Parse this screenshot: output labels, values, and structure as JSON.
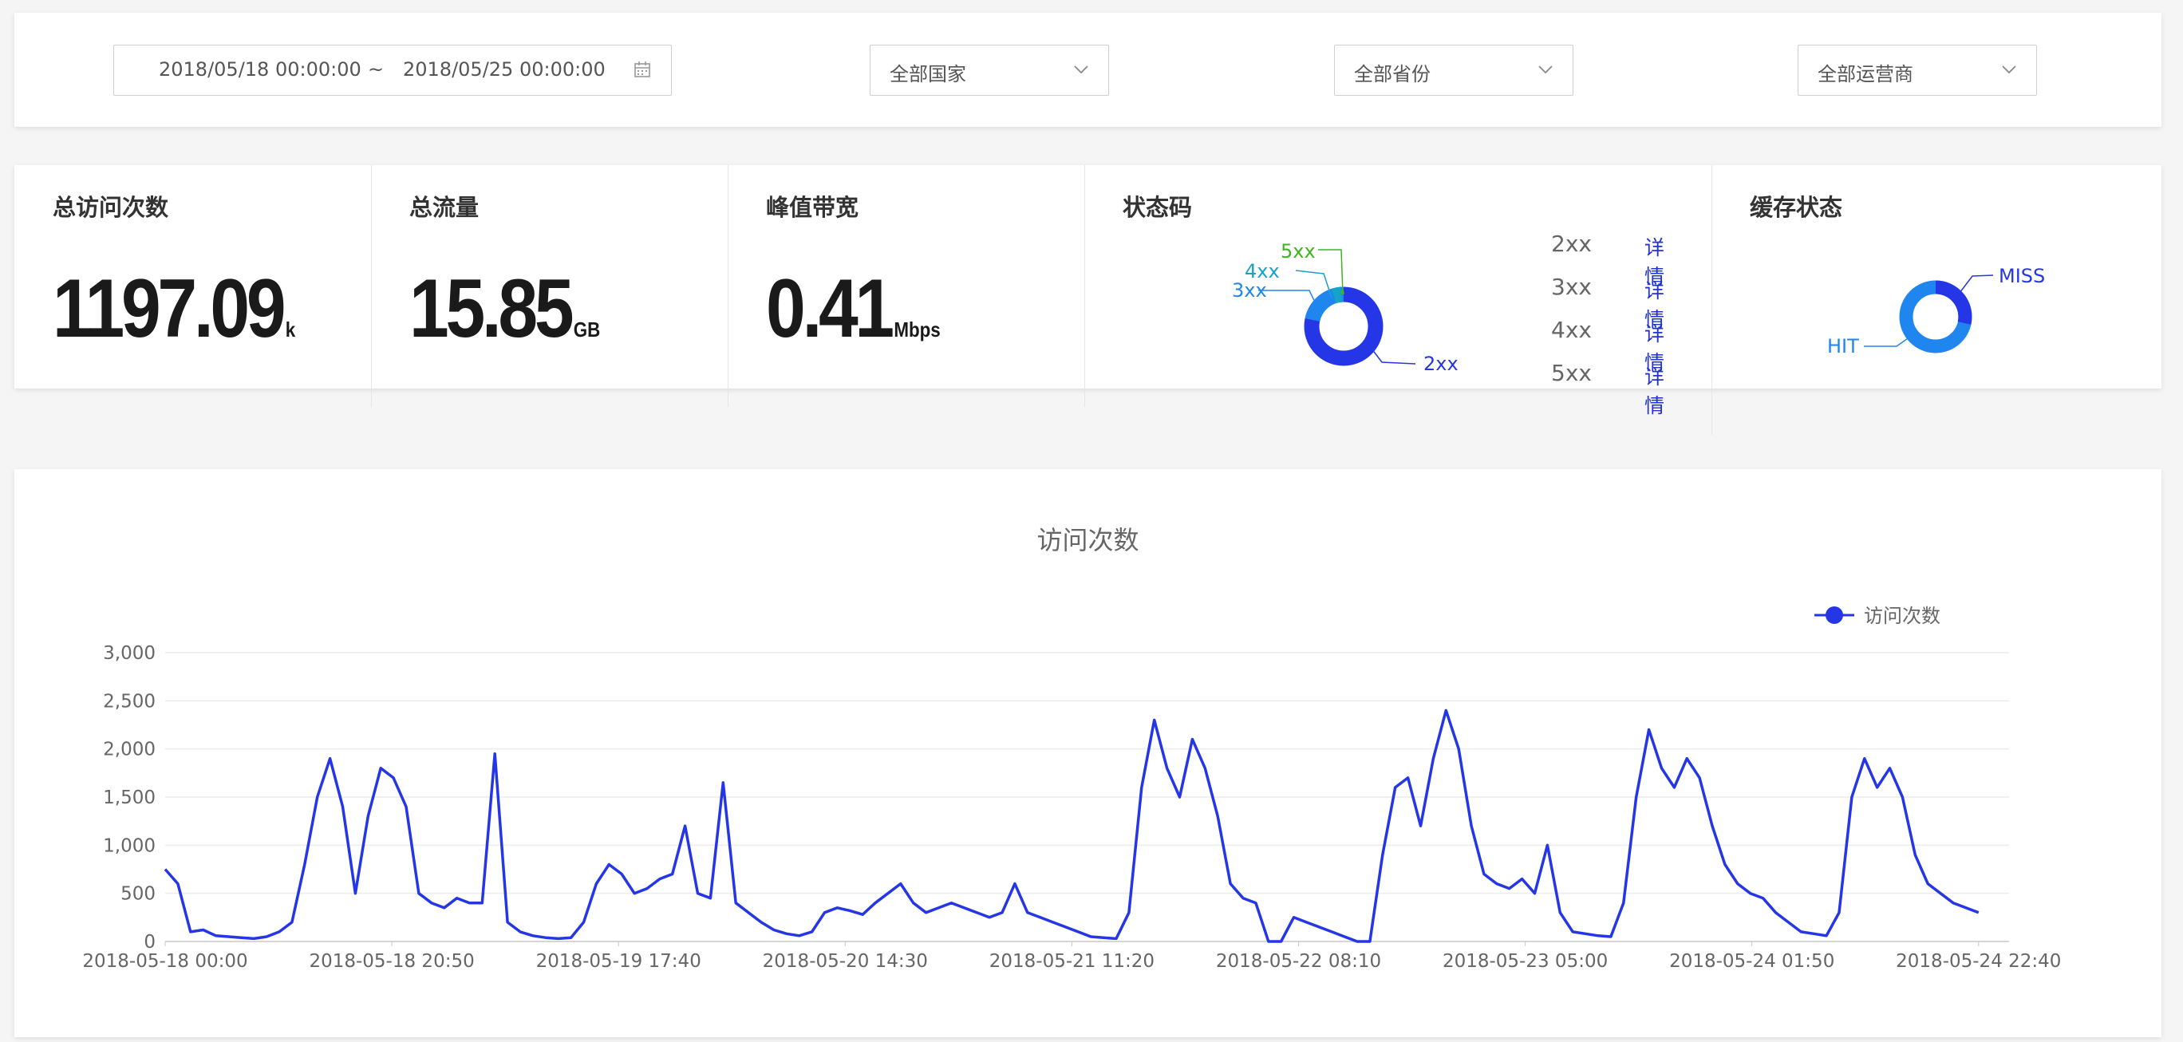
{
  "filters": {
    "date_start": "2018/05/18 00:00:00",
    "date_sep": "~",
    "date_end": "2018/05/25 00:00:00",
    "country": "全部国家",
    "province": "全部省份",
    "isp": "全部运营商"
  },
  "stats": {
    "visits": {
      "title": "总访问次数",
      "value": "1197.09",
      "unit": "k"
    },
    "traffic": {
      "title": "总流量",
      "value": "15.85",
      "unit": "GB"
    },
    "bandwidth": {
      "title": "峰值带宽",
      "value": "0.41",
      "unit": "Mbps"
    },
    "status_codes": {
      "title": "状态码",
      "codes": [
        "2xx",
        "3xx",
        "4xx",
        "5xx"
      ],
      "detail_label": "详情",
      "donut_labels": [
        "5xx",
        "4xx",
        "3xx",
        "2xx"
      ]
    },
    "cache": {
      "title": "缓存状态",
      "labels": [
        "MISS",
        "HIT"
      ]
    }
  },
  "colors": {
    "accent": "#2233cc",
    "series": "#2536e6",
    "light_blue": "#1f86f0",
    "teal": "#16a3c9",
    "green": "#3fb51c"
  },
  "chart_data": {
    "type": "line",
    "title": "访问次数",
    "legend": "访问次数",
    "legend_position": "top-right",
    "x_tick_labels": [
      "2018-05-18 00:00",
      "2018-05-18 20:50",
      "2018-05-19 17:40",
      "2018-05-20 14:30",
      "2018-05-21 11:20",
      "2018-05-22 08:10",
      "2018-05-23 05:00",
      "2018-05-24 01:50",
      "2018-05-24 22:40"
    ],
    "y_ticks": [
      "0",
      "500",
      "1,000",
      "1,500",
      "2,000",
      "2,500",
      "3,000"
    ],
    "ylim": [
      0,
      3000
    ],
    "grid": true,
    "x_start": "2018-05-18 00:00",
    "x_step_minutes": 10,
    "series": [
      {
        "name": "访问次数",
        "values": [
          750,
          600,
          100,
          120,
          60,
          50,
          40,
          30,
          50,
          100,
          200,
          800,
          1500,
          1900,
          1400,
          500,
          1300,
          1800,
          1700,
          1400,
          500,
          400,
          350,
          450,
          400,
          400,
          1950,
          200,
          100,
          60,
          40,
          30,
          40,
          200,
          600,
          800,
          700,
          500,
          550,
          650,
          700,
          1200,
          500,
          450,
          1650,
          400,
          300,
          200,
          120,
          80,
          60,
          100,
          300,
          350,
          320,
          280,
          400,
          500,
          600,
          400,
          300,
          350,
          400,
          350,
          300,
          250,
          300,
          600,
          300,
          250,
          200,
          150,
          100,
          50,
          40,
          30,
          300,
          1600,
          2300,
          1800,
          1500,
          2100,
          1800,
          1300,
          600,
          450,
          400,
          0,
          0,
          250,
          200,
          150,
          100,
          50,
          0,
          0,
          900,
          1600,
          1700,
          1200,
          1900,
          2400,
          2000,
          1200,
          700,
          600,
          550,
          650,
          500,
          1000,
          300,
          100,
          80,
          60,
          50,
          400,
          1500,
          2200,
          1800,
          1600,
          1900,
          1700,
          1200,
          800,
          600,
          500,
          450,
          300,
          200,
          100,
          80,
          60,
          300,
          1500,
          1900,
          1600,
          1800,
          1500,
          900,
          600,
          500,
          400,
          350,
          300
        ]
      }
    ]
  }
}
